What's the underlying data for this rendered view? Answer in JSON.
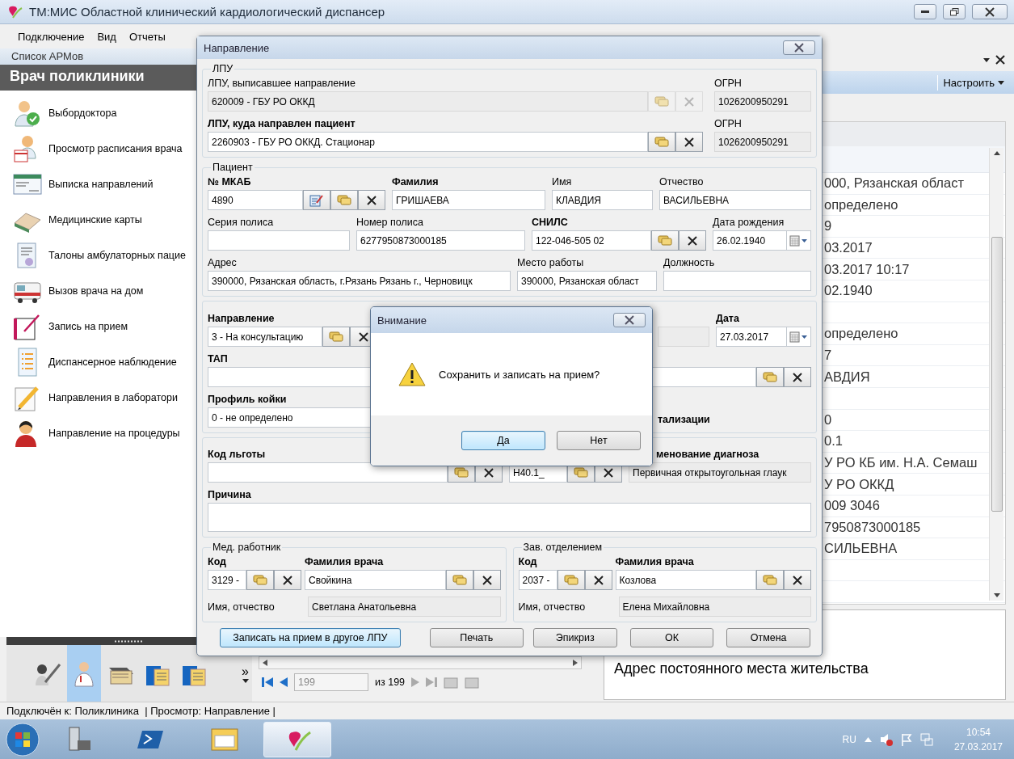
{
  "window": {
    "title": "ТМ:МИС Областной клинический кардиологический диспансер",
    "menu": [
      "Подключение",
      "Вид",
      "Отчеты"
    ]
  },
  "arm_panel": {
    "header": "Список АРМов",
    "title": "Врач поликлиники",
    "items": [
      {
        "label": "Выбордоктора",
        "kind": "doctor"
      },
      {
        "label": "Просмотр расписания врача",
        "kind": "calendar"
      },
      {
        "label": "Выписка направлений",
        "kind": "form"
      },
      {
        "label": "Медицинские карты",
        "kind": "book"
      },
      {
        "label": "Талоны амбулаторных пацие",
        "kind": "document"
      },
      {
        "label": "Вызов врача на дом",
        "kind": "ambulance"
      },
      {
        "label": "Запись на прием",
        "kind": "notebook"
      },
      {
        "label": "Диспансерное наблюдение",
        "kind": "list"
      },
      {
        "label": "Направления в лаборатори",
        "kind": "pencil"
      },
      {
        "label": "Направление на процедуры",
        "kind": "person"
      }
    ],
    "modules": [
      {
        "kind": "syringe",
        "selected": false
      },
      {
        "kind": "doctor",
        "selected": true
      },
      {
        "kind": "folders",
        "selected": false
      },
      {
        "kind": "briefcase",
        "selected": false
      },
      {
        "kind": "briefcase",
        "selected": false
      }
    ],
    "more": "»"
  },
  "pager": {
    "page": "199",
    "total": "из 199"
  },
  "right_panel": {
    "settings": "Настроить",
    "rows": [
      {
        "kind": "text",
        "text": "000, Рязанская област"
      },
      {
        "kind": "text",
        "text": "определено"
      },
      {
        "kind": "text",
        "text": "9"
      },
      {
        "kind": "text",
        "text": "03.2017"
      },
      {
        "kind": "text",
        "text": "03.2017 10:17"
      },
      {
        "kind": "text",
        "text": "02.1940"
      },
      {
        "kind": "blank"
      },
      {
        "kind": "text",
        "text": "определено"
      },
      {
        "kind": "text",
        "text": "7"
      },
      {
        "kind": "text",
        "text": "АВДИЯ"
      },
      {
        "kind": "blank"
      },
      {
        "kind": "text",
        "text": "0"
      },
      {
        "kind": "text",
        "text": "0.1"
      },
      {
        "kind": "text",
        "text": "У РО КБ им. Н.А. Семаш"
      },
      {
        "kind": "text",
        "text": "У РО ОККД"
      },
      {
        "kind": "text",
        "text": "009   3046"
      },
      {
        "kind": "text",
        "text": "7950873000185"
      },
      {
        "kind": "text",
        "text": "СИЛЬЕВНА"
      },
      {
        "kind": "blank"
      },
      {
        "kind": "blank"
      }
    ],
    "footer": "Адрес постоянного места жительства"
  },
  "dialog": {
    "title": "Направление",
    "lpu": {
      "legend": "ЛПУ",
      "rows": [
        {
          "field": {
            "label": "ЛПУ, выписавшее направление",
            "required": false,
            "value": "620009 - ГБУ РО ОККД",
            "readonly": true,
            "buttons": [
              {
                "kind": "pick"
              },
              {
                "kind": "clear"
              }
            ]
          },
          "ogrn": {
            "label": "ОГРН",
            "required": false,
            "value": "1026200950291",
            "readonly": true
          }
        },
        {
          "field": {
            "label": "ЛПУ, куда направлен пациент",
            "required": true,
            "value": "2260903 - ГБУ РО ОККД. Стационар",
            "readonly": false,
            "buttons": [
              {
                "kind": "pick"
              },
              {
                "kind": "clear"
              }
            ]
          },
          "ogrn": {
            "label": "ОГРН",
            "required": false,
            "value": "1026200950291",
            "readonly": true
          }
        }
      ]
    },
    "patient": {
      "legend": "Пациент",
      "rows": [
        {
          "fields": [
            {
              "label": "№ МКАБ",
              "required": true,
              "value": "4890",
              "readonly": false,
              "buttons": [
                {
                  "kind": "edit"
                },
                {
                  "kind": "pick"
                },
                {
                  "kind": "clear"
                }
              ]
            },
            {
              "label": "Фамилия",
              "required": true,
              "value": "ГРИШАЕВА",
              "readonly": false
            },
            {
              "label": "Имя",
              "required": false,
              "value": "КЛАВДИЯ",
              "readonly": false
            },
            {
              "label": "Отчество",
              "required": false,
              "value": "ВАСИЛЬЕВНА",
              "readonly": false
            }
          ]
        },
        {
          "fields": [
            {
              "label": "Серия полиса",
              "required": false,
              "readonly": false
            },
            {
              "label": "Номер полиса",
              "required": false,
              "value": "6277950873000185",
              "readonly": false
            },
            {
              "label": "СНИЛС",
              "required": true,
              "value": "122-046-505 02",
              "readonly": false,
              "buttons": [
                {
                  "kind": "pick"
                },
                {
                  "kind": "clear"
                }
              ]
            },
            {
              "label": "Дата рождения",
              "required": false,
              "value": "26.02.1940",
              "readonly": false,
              "buttons": [
                {
                  "kind": "calendar"
                }
              ]
            }
          ]
        },
        {
          "fields": [
            {
              "label": "Адрес",
              "required": false,
              "value": "390000, Рязанская область, г.Рязань Рязань г., Черновицк",
              "readonly": false
            },
            {
              "label": "Место работы",
              "required": false,
              "value": "390000, Рязанская област",
              "readonly": false
            },
            {
              "label": "Должность",
              "required": false,
              "readonly": false
            }
          ]
        }
      ]
    },
    "referral": {
      "rows": [
        {
          "fields": [
            {
              "label": "Направление",
              "required": true,
              "value": "3 - На консультацию",
              "readonly": false,
              "buttons": [
                {
                  "kind": "pick"
                },
                {
                  "kind": "clear"
                }
              ]
            },
            {
              "readonly": true
            },
            {
              "label": "Дата",
              "required": true,
              "value": "27.03.2017",
              "readonly": false,
              "buttons": [
                {
                  "kind": "calendar"
                }
              ]
            }
          ]
        },
        {
          "fields": [
            {
              "label": "ТАП",
              "required": true,
              "readonly": false,
              "buttons": [
                {
                  "kind": "pick"
                },
                {
                  "kind": "clear"
                }
              ]
            }
          ]
        },
        {
          "fields": [
            {
              "label": "Профиль койки",
              "required": true,
              "value": "0 - не определено",
              "readonly": false
            },
            {
              "label": "тализации",
              "required": true
            }
          ]
        }
      ]
    },
    "diagnosis": {
      "fields": [
        {
          "label": "Код льготы",
          "required": true,
          "readonly": false,
          "buttons": [
            {
              "kind": "pick"
            },
            {
              "kind": "clear"
            }
          ]
        },
        {
          "value": "Н40.1_",
          "readonly": false,
          "buttons": [
            {
              "kind": "pick"
            },
            {
              "kind": "clear"
            }
          ]
        },
        {
          "label": "менование диагноза",
          "required": true,
          "value": "Первичная открытоугольная глаук",
          "readonly": true
        }
      ],
      "reason": {
        "label": "Причина",
        "required": true
      }
    },
    "staff": [
      {
        "legend": "Мед. работник",
        "code": {
          "label": "Код",
          "required": true,
          "value": "3129 -",
          "readonly": false,
          "buttons": [
            {
              "kind": "pick"
            },
            {
              "kind": "clear"
            }
          ]
        },
        "surname": {
          "label": "Фамилия врача",
          "required": true,
          "value": "Свойкина",
          "readonly": false,
          "buttons": [
            {
              "kind": "pick"
            },
            {
              "kind": "clear"
            }
          ]
        },
        "name_label": "Имя, отчество",
        "name": "Светлана Анатольевна"
      },
      {
        "legend": "Зав. отделением",
        "code": {
          "label": "Код",
          "required": true,
          "value": "2037 -",
          "readonly": false,
          "buttons": [
            {
              "kind": "pick"
            },
            {
              "kind": "clear"
            }
          ]
        },
        "surname": {
          "label": "Фамилия врача",
          "required": true,
          "value": "Козлова",
          "readonly": false,
          "buttons": [
            {
              "kind": "pick"
            },
            {
              "kind": "clear"
            }
          ]
        },
        "name_label": "Имя, отчество",
        "name": "Елена Михайловна"
      }
    ],
    "buttons": [
      {
        "label": "Записать на прием в другое ЛПУ",
        "focused": true
      },
      {
        "label": "Печать",
        "focused": false
      },
      {
        "label": "Эпикриз",
        "focused": false
      },
      {
        "label": "ОК",
        "focused": false
      },
      {
        "label": "Отмена",
        "focused": false
      }
    ]
  },
  "alert": {
    "title": "Внимание",
    "message": "Сохранить и записать на прием?",
    "buttons": [
      {
        "label": "Да",
        "focused": true
      },
      {
        "label": "Нет",
        "focused": false
      }
    ]
  },
  "status_bar": "Подключён к: Поликлиника  | Просмотр: Направление |",
  "taskbar": {
    "apps": [
      {
        "kind": "server",
        "selected": false
      },
      {
        "kind": "shell",
        "selected": false
      },
      {
        "kind": "folder",
        "selected": false
      },
      {
        "kind": "heart",
        "selected": true
      }
    ],
    "language": "RU",
    "time": "10:54",
    "date": "27.03.2017"
  }
}
